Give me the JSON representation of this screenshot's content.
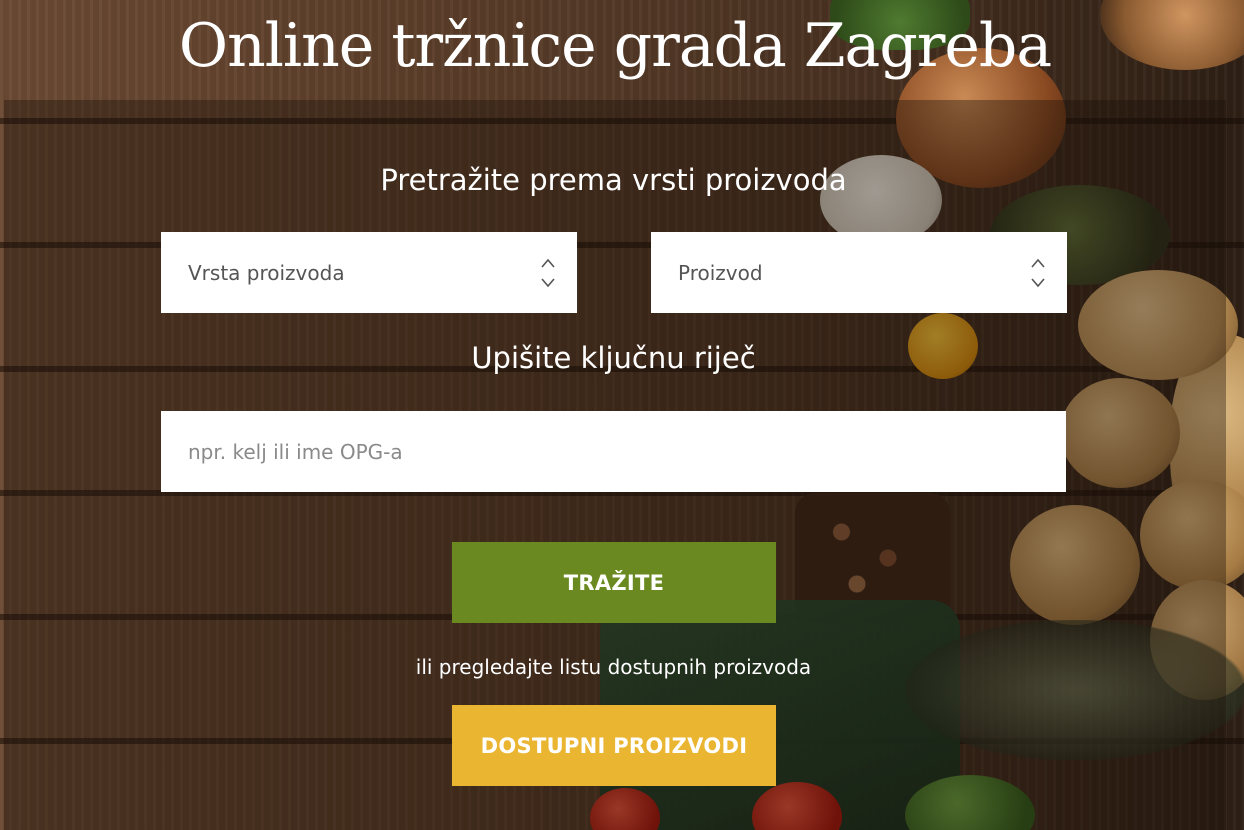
{
  "page": {
    "title": "Online tržnice grada Zagreba"
  },
  "search_by_type": {
    "heading": "Pretražite prema vrsti proizvoda",
    "type_select": {
      "value": "Vrsta proizvoda",
      "icon": "updown-chevron-icon"
    },
    "product_select": {
      "value": "Proizvod",
      "icon": "updown-chevron-icon"
    }
  },
  "keyword_search": {
    "heading": "Upišite ključnu riječ",
    "placeholder": "npr. kelj ili ime OPG-a",
    "value": ""
  },
  "actions": {
    "search_label": "TRAŽITE",
    "or_text": "ili pregledajte listu dostupnih proizvoda",
    "available_label": "DOSTUPNI PROIZVODI"
  },
  "colors": {
    "search_button": "#6a8a21",
    "available_button": "#eab531",
    "text": "#ffffff"
  }
}
